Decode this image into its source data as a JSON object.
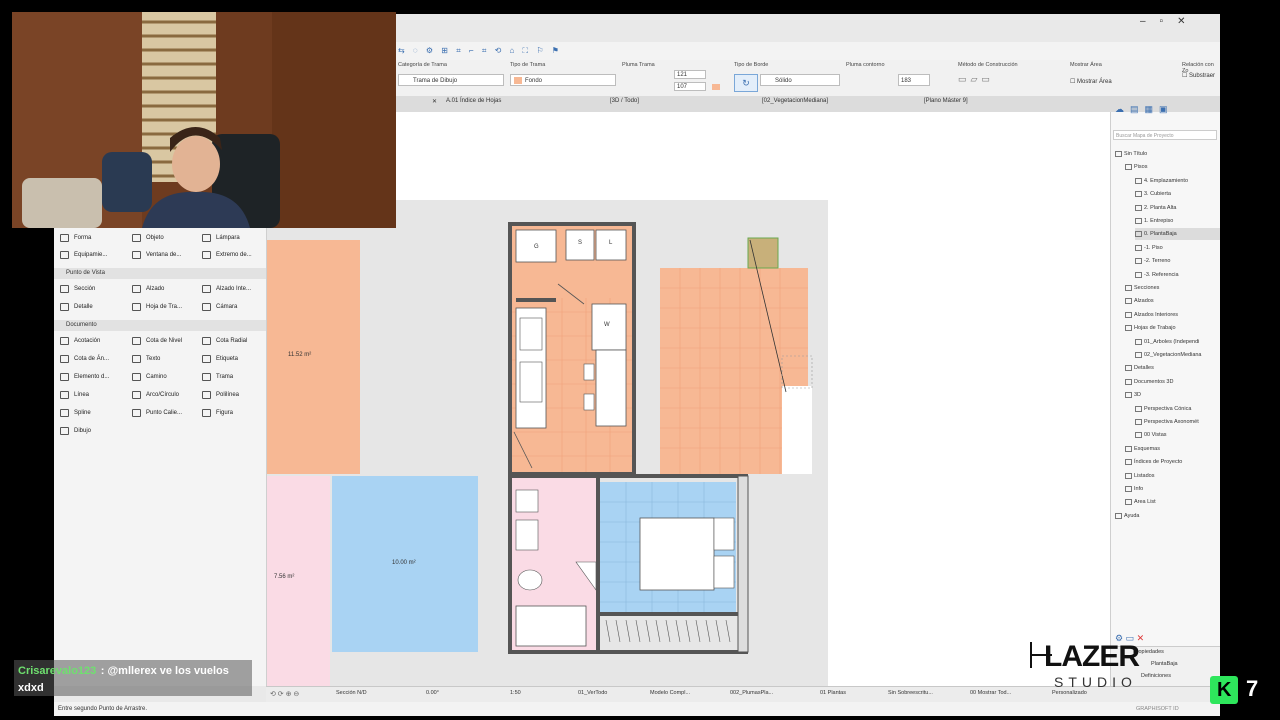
{
  "infobox": {
    "groups": [
      {
        "label": "Categoría de Trama",
        "value": "Trama de Dibujo"
      },
      {
        "label": "Tipo de Trama",
        "value": "Fondo"
      },
      {
        "label": "Pluma Trama",
        "value1": "121",
        "value2": "107"
      },
      {
        "label": "Tipo de Borde",
        "value": "Sólido"
      },
      {
        "label": "Pluma contorno",
        "value": "183"
      },
      {
        "label": "Método de Construcción",
        "value": ""
      },
      {
        "label": "Mostrar Área",
        "value": "Mostrar Área"
      },
      {
        "label": "Relación con Zo",
        "value": "Substraer"
      }
    ]
  },
  "tabs": [
    "A.01 Índice de Hojas",
    "[3D / Todo]",
    "[02_VegetacionMediana]",
    "[Plano Máster 9]"
  ],
  "toolbox": {
    "items_top": [
      [
        "Forma",
        "Objeto",
        "Lámpara"
      ],
      [
        "Equipamie...",
        "Ventana de...",
        "Extremo de..."
      ]
    ],
    "section1": "Punto de Vista",
    "items_mid": [
      [
        "Sección",
        "Alzado",
        "Alzado Inte..."
      ],
      [
        "Detalle",
        "Hoja de Tra...",
        "Cámara"
      ]
    ],
    "section2": "Documento",
    "items_doc": [
      [
        "Acotación",
        "Cota de Nivel",
        "Cota Radial"
      ],
      [
        "Cota de Án...",
        "Texto",
        "Etiqueta"
      ],
      [
        "Elemento d...",
        "Camino",
        "Trama"
      ],
      [
        "Línea",
        "Arco/Círculo",
        "Polilínea"
      ],
      [
        "Spline",
        "Punto Calie...",
        "Figura"
      ],
      [
        "Dibujo",
        "",
        ""
      ]
    ]
  },
  "rooms": {
    "left_top_area": "11.52 m²",
    "left_bottom_area": "7.56 m²",
    "blue_area": "10.00 m²",
    "kitchen_labels": [
      "G",
      "S",
      "L"
    ],
    "fridge_label": "W"
  },
  "navigator": {
    "search_placeholder": "Buscar Mapa de Proyecto",
    "items": [
      {
        "label": "Sin Título",
        "level": 0
      },
      {
        "label": "Pisos",
        "level": 1
      },
      {
        "label": "4. Emplazamiento",
        "level": 2
      },
      {
        "label": "3. Cubierta",
        "level": 2
      },
      {
        "label": "2. Planta Alta",
        "level": 2
      },
      {
        "label": "1. Entrepiso",
        "level": 2
      },
      {
        "label": "0. PlantaBaja",
        "level": 2,
        "selected": true
      },
      {
        "label": "-1. Piso",
        "level": 2
      },
      {
        "label": "-2. Terreno",
        "level": 2
      },
      {
        "label": "-3. Referencia",
        "level": 2
      },
      {
        "label": "Secciones",
        "level": 1
      },
      {
        "label": "Alzados",
        "level": 1
      },
      {
        "label": "Alzados Interiores",
        "level": 1
      },
      {
        "label": "Hojas de Trabajo",
        "level": 1
      },
      {
        "label": "01_Arboles (Independi",
        "level": 2
      },
      {
        "label": "02_VegetacionMediana",
        "level": 2
      },
      {
        "label": "Detalles",
        "level": 1
      },
      {
        "label": "Documentos 3D",
        "level": 1
      },
      {
        "label": "3D",
        "level": 1
      },
      {
        "label": "Perspectiva Cónica",
        "level": 2
      },
      {
        "label": "Perspectiva Axonomét",
        "level": 2
      },
      {
        "label": "00 Vistas",
        "level": 2
      },
      {
        "label": "Esquemas",
        "level": 1
      },
      {
        "label": "Índices de Proyecto",
        "level": 1
      },
      {
        "label": "Listados",
        "level": 1
      },
      {
        "label": "Info",
        "level": 1
      },
      {
        "label": "Area List",
        "level": 1
      },
      {
        "label": "Ayuda",
        "level": 0
      }
    ],
    "properties_label": "Propiedades",
    "properties_value": "PlantaBaja",
    "definitions": "Definiciones",
    "vendor": "GRAPHISOFT ID"
  },
  "statusbar": {
    "items": [
      "Sección N/D",
      "0.00°",
      "1:50",
      "01_VerTodo",
      "Modelo Compl...",
      "002_PlumasPla...",
      "01 Plantas",
      "Sin Sobreescritu...",
      "00 Mostrar Tod...",
      "Personalizado"
    ]
  },
  "hint": "Entre segundo Punto de Arrastre.",
  "chat": {
    "user": "Crisarevalo123",
    "message": ": @mllerex ve los vuelos xdxd"
  },
  "logo": {
    "main": "LAZER",
    "sub": "STUDIO"
  },
  "overlay_badge": "7",
  "colors": {
    "salmon": "#f7b894",
    "blue": "#a9d3f3",
    "pink": "#fadbe5",
    "wall": "#555555",
    "green_logo": "#2ee65c"
  }
}
